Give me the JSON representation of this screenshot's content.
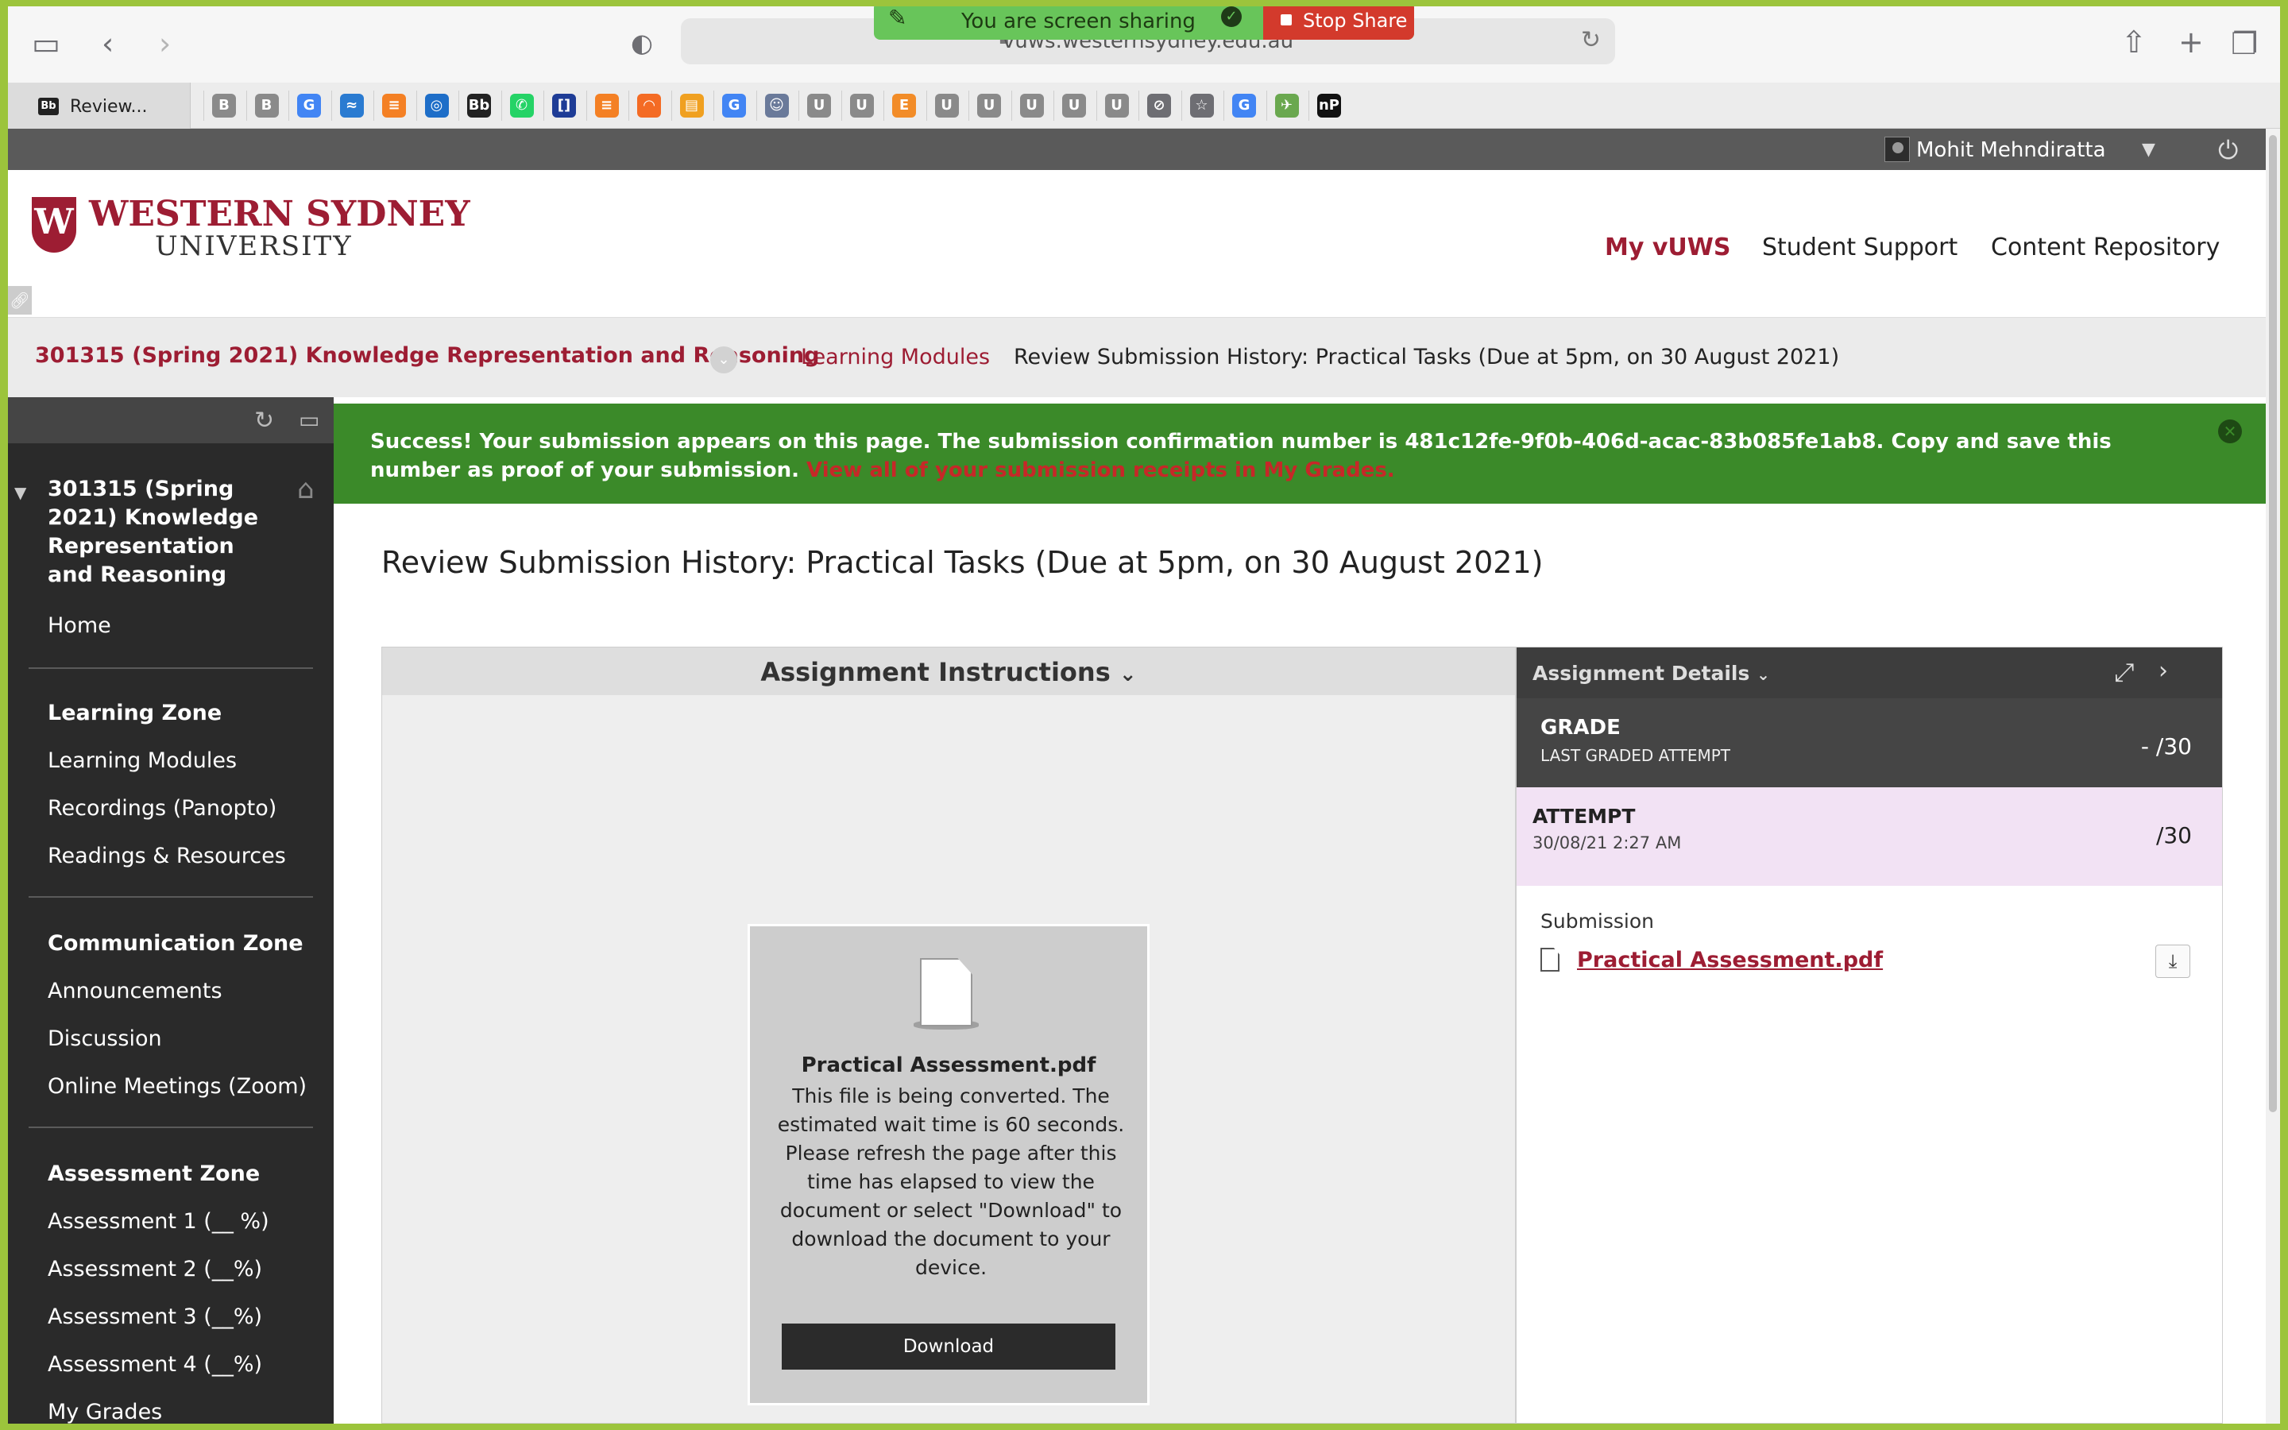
{
  "browser": {
    "url": "vuws.westernsydney.edu.au",
    "sharing_text": "You are screen sharing",
    "stop_share": "Stop Share",
    "active_tab": "Review...",
    "active_tab_favicon": "Bb",
    "bookmarks": [
      {
        "icon": "B",
        "color": "#8a8a8a"
      },
      {
        "icon": "B",
        "color": "#8a8a8a"
      },
      {
        "icon": "G",
        "color": "#4285f4"
      },
      {
        "icon": "≈",
        "color": "#2a7bd1"
      },
      {
        "icon": "≡",
        "color": "#f48024"
      },
      {
        "icon": "◎",
        "color": "#1e6ec8"
      },
      {
        "icon": "Bb",
        "color": "#222222"
      },
      {
        "icon": "✆",
        "color": "#25d366"
      },
      {
        "icon": "[]",
        "color": "#1e3c96"
      },
      {
        "icon": "≡",
        "color": "#f48024"
      },
      {
        "icon": "◠",
        "color": "#f46b24"
      },
      {
        "icon": "▤",
        "color": "#f0a020"
      },
      {
        "icon": "G",
        "color": "#4285f4"
      },
      {
        "icon": "☺",
        "color": "#6a7a9a"
      },
      {
        "icon": "U",
        "color": "#8a8a8a"
      },
      {
        "icon": "U",
        "color": "#8a8a8a"
      },
      {
        "icon": "E",
        "color": "#f28c28"
      },
      {
        "icon": "U",
        "color": "#8a8a8a"
      },
      {
        "icon": "U",
        "color": "#8a8a8a"
      },
      {
        "icon": "U",
        "color": "#8a8a8a"
      },
      {
        "icon": "U",
        "color": "#8a8a8a"
      },
      {
        "icon": "U",
        "color": "#8a8a8a"
      },
      {
        "icon": "⊘",
        "color": "#6e6e73"
      },
      {
        "icon": "☆",
        "color": "#6e6e73"
      },
      {
        "icon": "G",
        "color": "#4285f4"
      },
      {
        "icon": "✈",
        "color": "#6aa84f"
      },
      {
        "icon": "nP",
        "color": "#111111"
      }
    ]
  },
  "user": {
    "name": "Mohit Mehndiratta"
  },
  "header": {
    "logo_line1": "WESTERN SYDNEY",
    "logo_line2": "UNIVERSITY",
    "crest_letter": "W",
    "nav": [
      "My vUWS",
      "Student Support",
      "Content Repository"
    ]
  },
  "breadcrumb": {
    "course": "301315 (Spring 2021) Knowledge Representation and Reasoning",
    "link": "Learning Modules",
    "current": "Review Submission History: Practical Tasks (Due at 5pm, on 30 August 2021)"
  },
  "sidebar": {
    "course_title": "301315 (Spring 2021) Knowledge Representation and Reasoning",
    "home": "Home",
    "learning_zone": "Learning Zone",
    "learning_items": [
      "Learning Modules",
      "Recordings (Panopto)",
      "Readings & Resources"
    ],
    "communication_zone": "Communication Zone",
    "communication_items": [
      "Announcements",
      "Discussion",
      "Online Meetings (Zoom)"
    ],
    "assessment_zone": "Assessment Zone",
    "assessment_items": [
      "Assessment 1 (__ %)",
      "Assessment 2 (__%)",
      "Assessment 3 (__%)",
      "Assessment 4 (__%)",
      "My Grades"
    ]
  },
  "success": {
    "text": "Success! Your submission appears on this page. The submission confirmation number is 481c12fe-9f0b-406d-acac-83b085fe1ab8. Copy and save this number as proof of your submission.",
    "link": "View all of your submission receipts in My Grades."
  },
  "page_title": "Review Submission History: Practical Tasks (Due at 5pm, on 30 August 2021)",
  "instructions": {
    "title": "Assignment Instructions",
    "file_name": "Practical Assessment.pdf",
    "message": "This file is being converted. The estimated wait time is 60 seconds. Please refresh the page after this time has elapsed to view the document or select \"Download\" to download the document to your device.",
    "download": "Download"
  },
  "details": {
    "title": "Assignment Details",
    "grade_label": "GRADE",
    "grade_sub": "LAST GRADED ATTEMPT",
    "grade_value": "- /30",
    "attempt_label": "ATTEMPT",
    "attempt_date": "30/08/21 2:27 AM",
    "attempt_value": "/30",
    "submission_label": "Submission",
    "submission_file": "Practical Assessment.pdf"
  }
}
